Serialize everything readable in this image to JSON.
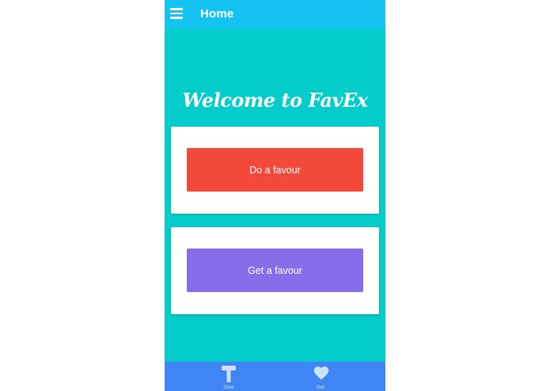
{
  "header": {
    "title": "Home",
    "menu_icon": "hamburger-menu-icon"
  },
  "main": {
    "welcome_text": "Welcome to FavEx",
    "do_favour_label": "Do a favour",
    "get_favour_label": "Get a favour"
  },
  "tabbar": {
    "tabs": [
      {
        "label": "Give",
        "icon": "hammer-icon"
      },
      {
        "label": "Get",
        "icon": "heart-icon"
      }
    ]
  },
  "colors": {
    "header_bg": "#15c3f1",
    "page_bg": "#03cccb",
    "do_favour_button": "#f2493b",
    "get_favour_button": "#876dea",
    "tabbar_bg": "#3f86f4"
  }
}
